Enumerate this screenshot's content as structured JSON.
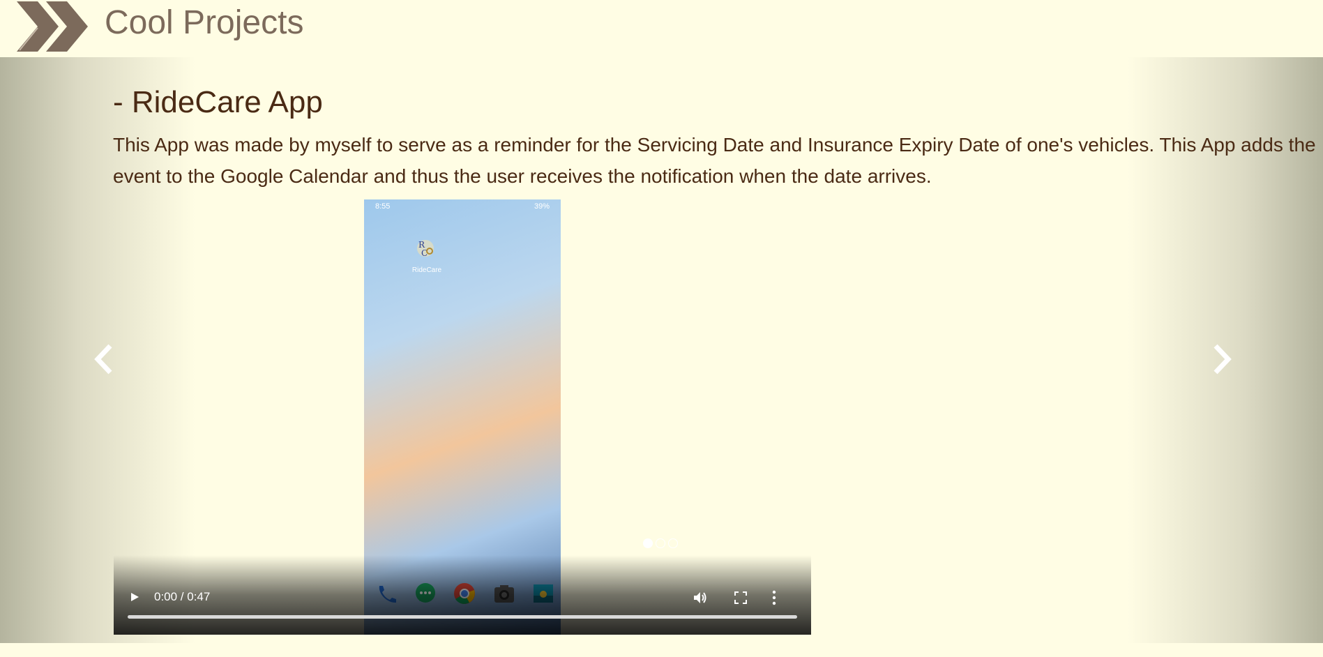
{
  "header": {
    "title": "Cool Projects",
    "logo_icon": "double-chevron-icon",
    "logo_colors": [
      "#7c6a5b",
      "#a08f80"
    ]
  },
  "carousel": {
    "prev_icon": "chevron-left-icon",
    "next_icon": "chevron-right-icon",
    "slide": {
      "title": "- RideCare App",
      "description": "This App was made by myself to serve as a reminder for the Servicing Date and Insurance Expiry Date of one's vehicles. This App adds the event to the Google Calendar and thus the user receives the notification when the date arrives."
    },
    "indicators": [
      {
        "active": true
      },
      {
        "active": false
      },
      {
        "active": false
      }
    ]
  },
  "video": {
    "time": "0:00 / 0:47",
    "progress_fraction": 0,
    "phone_status_time": "8:55",
    "phone_status_right": "39%",
    "app_label": "RideCare",
    "dock_icons": [
      "phone-icon",
      "messages-icon",
      "chrome-icon",
      "camera-icon",
      "gallery-icon"
    ]
  },
  "colors": {
    "background": "#fffde4",
    "text": "#4a2a14",
    "header_text": "#7c6a5b"
  }
}
